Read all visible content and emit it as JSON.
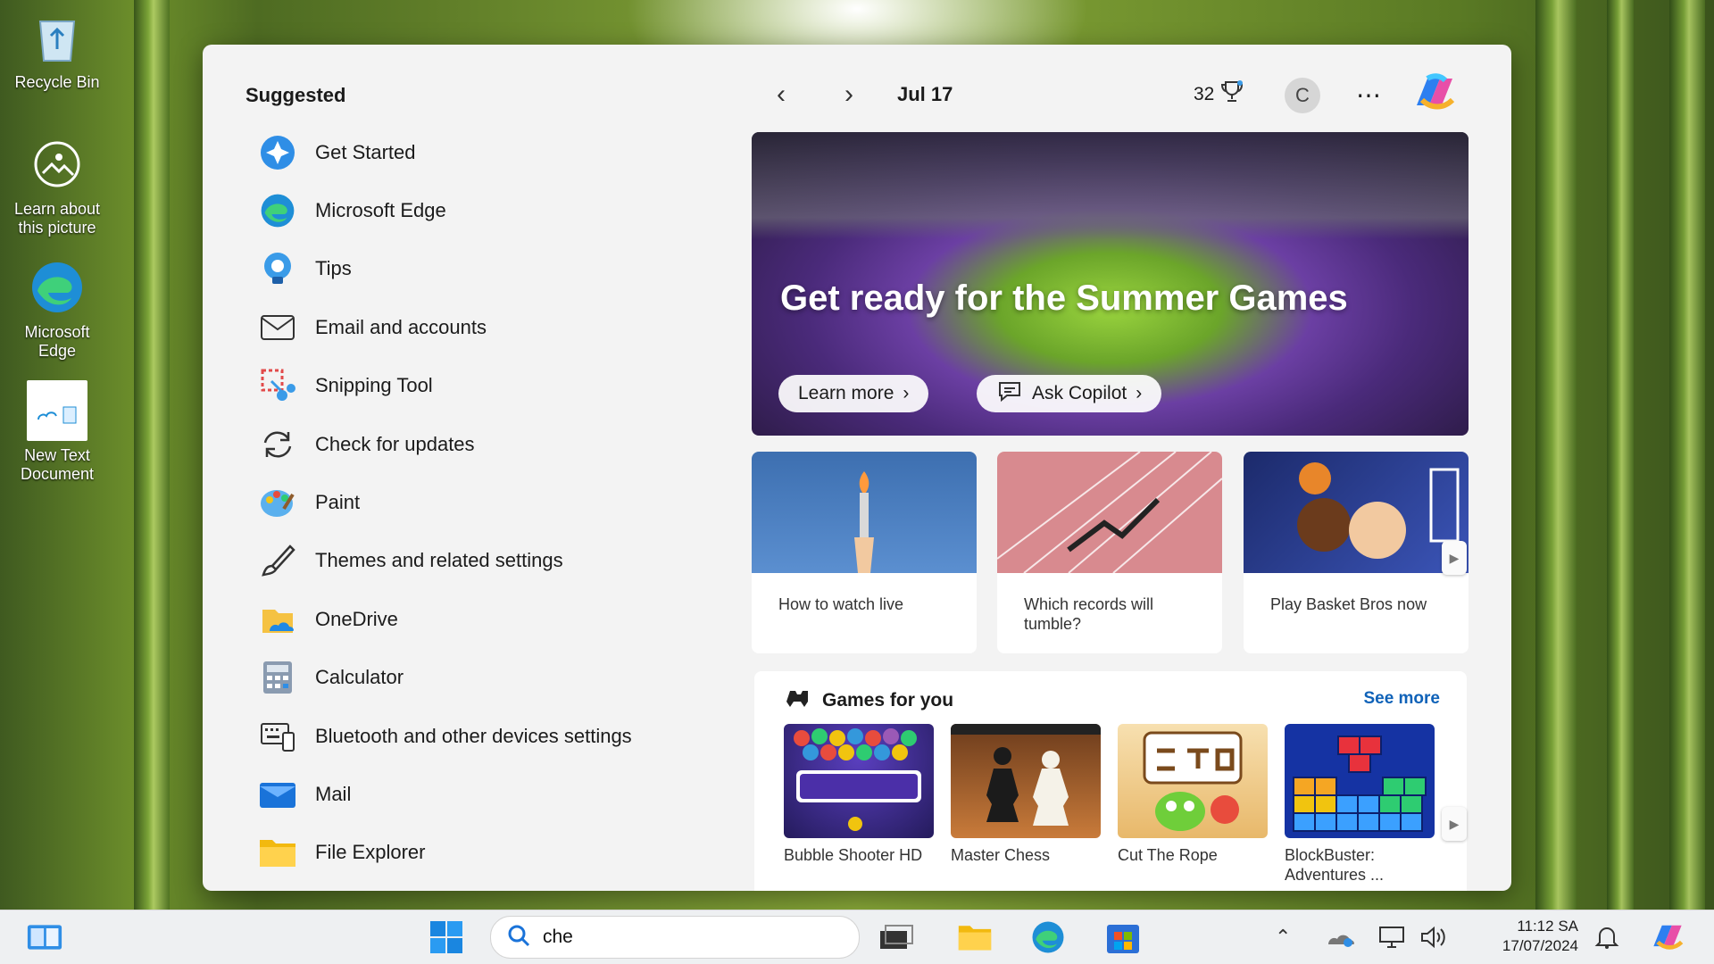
{
  "desktop": {
    "icons": [
      {
        "label": "Recycle Bin"
      },
      {
        "label": "Learn about this picture"
      },
      {
        "label": "Microsoft Edge"
      },
      {
        "label": "New Text Document"
      }
    ]
  },
  "start": {
    "suggested_title": "Suggested",
    "suggested": [
      {
        "label": "Get Started",
        "icon": "get-started-icon"
      },
      {
        "label": "Microsoft Edge",
        "icon": "edge-icon"
      },
      {
        "label": "Tips",
        "icon": "tips-icon"
      },
      {
        "label": "Email and accounts",
        "icon": "mail-outline-icon"
      },
      {
        "label": "Snipping Tool",
        "icon": "snipping-tool-icon"
      },
      {
        "label": "Check for updates",
        "icon": "refresh-icon"
      },
      {
        "label": "Paint",
        "icon": "paint-icon"
      },
      {
        "label": "Themes and related settings",
        "icon": "brush-icon"
      },
      {
        "label": "OneDrive",
        "icon": "onedrive-icon"
      },
      {
        "label": "Calculator",
        "icon": "calculator-icon"
      },
      {
        "label": "Bluetooth and other devices settings",
        "icon": "devices-icon"
      },
      {
        "label": "Mail",
        "icon": "mail-icon"
      },
      {
        "label": "File Explorer",
        "icon": "folder-icon"
      }
    ]
  },
  "widgets": {
    "date": "Jul 17",
    "points": "32",
    "avatar_initial": "C",
    "hero": {
      "title": "Get ready for the Summer Games",
      "learn_more": "Learn more",
      "ask_copilot": "Ask Copilot"
    },
    "cards": [
      {
        "text": "How to watch live"
      },
      {
        "text": "Which records will tumble?"
      },
      {
        "text": "Play Basket Bros now"
      }
    ],
    "games": {
      "title": "Games for you",
      "see_more": "See more",
      "items": [
        {
          "name": "Bubble Shooter HD"
        },
        {
          "name": "Master Chess"
        },
        {
          "name": "Cut The Rope"
        },
        {
          "name": "BlockBuster: Adventures ..."
        }
      ]
    }
  },
  "taskbar": {
    "search_value": "che",
    "time": "11:12 SA",
    "date": "17/07/2024"
  },
  "colors": {
    "accent": "#0f62b8",
    "panel": "#f3f3f3"
  }
}
